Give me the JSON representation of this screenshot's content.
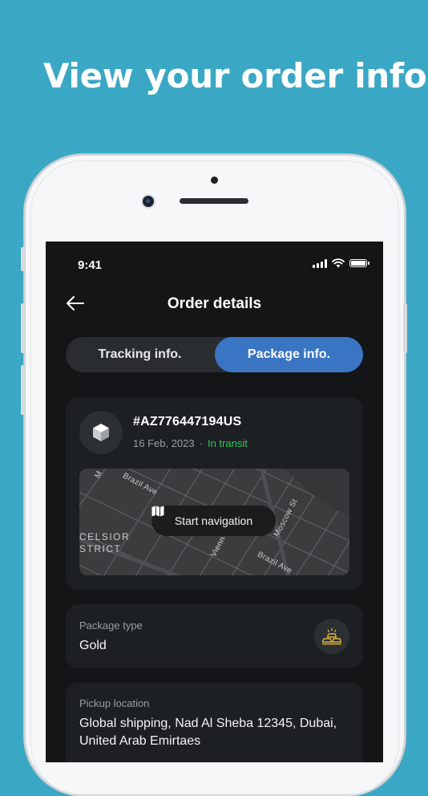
{
  "headline": "View your order info",
  "status_bar": {
    "time": "9:41",
    "icons": [
      "signal-icon",
      "wifi-icon",
      "battery-icon"
    ]
  },
  "header": {
    "title": "Order details",
    "back_icon": "arrow-left-icon"
  },
  "tabs": [
    {
      "label": "Tracking info.",
      "active": false
    },
    {
      "label": "Package info.",
      "active": true
    }
  ],
  "order": {
    "id": "#AZ776447194US",
    "date": "16 Feb, 2023",
    "separator": "·",
    "status": "In transit",
    "icon": "package-box-icon",
    "map": {
      "labels": [
        "Brazil Ave",
        "Moscow St",
        "Brazil Ave",
        "Vienn",
        "M",
        "CELSIOR",
        "STRICT"
      ],
      "nav_button": "Start navigation",
      "nav_icon": "map-icon"
    }
  },
  "package_type": {
    "label": "Package type",
    "value": "Gold",
    "icon": "gold-bars-icon"
  },
  "pickup": {
    "label": "Pickup location",
    "value": "Global shipping, Nad Al Sheba 12345, Dubai, United Arab Emirtaes"
  },
  "colors": {
    "background": "#3aa8c4",
    "screen": "#131517",
    "card": "#1d2023",
    "accent": "#3a75c4",
    "status_green": "#34c759",
    "gold": "#e0b23a"
  }
}
